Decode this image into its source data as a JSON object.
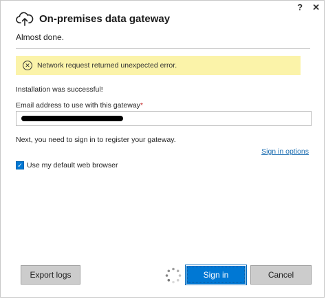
{
  "window": {
    "help_glyph": "?",
    "close_glyph": "✕"
  },
  "header": {
    "icon": "cloud-upload-icon",
    "title": "On-premises data gateway"
  },
  "subtitle": "Almost done.",
  "error": {
    "icon": "error-circle-x-icon",
    "icon_glyph": "✕",
    "message": "Network request returned unexpected error.",
    "background_color": "#fbf3a9"
  },
  "status": "Installation was successful!",
  "email": {
    "label": "Email address to use with this gateway",
    "required_marker": "*",
    "value": ""
  },
  "next_text": "Next, you need to sign in to register your gateway.",
  "sign_in_options_link": "Sign in options",
  "browser_option": {
    "checked": true,
    "check_glyph": "✓",
    "label": "Use my default web browser"
  },
  "buttons": {
    "export_logs": "Export logs",
    "sign_in": "Sign in",
    "cancel": "Cancel"
  },
  "colors": {
    "accent": "#0078d4",
    "link": "#1f6fb2"
  }
}
